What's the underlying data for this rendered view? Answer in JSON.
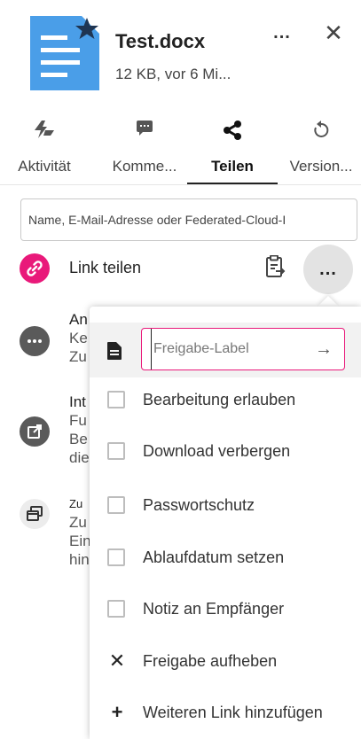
{
  "header": {
    "file_name": "Test.docx",
    "file_meta": "12 KB, vor 6 Mi...",
    "more_label": "...",
    "close_label": "✕"
  },
  "tabs": [
    {
      "label": "Aktivität",
      "icon": "activity-icon",
      "active": false
    },
    {
      "label": "Komme...",
      "icon": "comment-icon",
      "active": false
    },
    {
      "label": "Teilen",
      "icon": "share-icon",
      "active": true
    },
    {
      "label": "Version...",
      "icon": "history-icon",
      "active": false
    }
  ],
  "share_search": {
    "placeholder": "Name, E-Mail-Adresse oder Federated-Cloud-I"
  },
  "link_share": {
    "label": "Link teilen",
    "accent": "#e9197a",
    "menu_label": "..."
  },
  "background_items": [
    {
      "lines": [
        "An",
        "Ke",
        "Zu"
      ],
      "icon": "more-icon"
    },
    {
      "lines": [
        "Int",
        "Fu",
        "Be",
        "die"
      ],
      "icon": "external-link-icon"
    },
    {
      "lines": [
        "Zu",
        "Zu",
        "Ein",
        "hin"
      ],
      "icon": "windows-icon"
    }
  ],
  "popup": {
    "label_input_placeholder": "Freigabe-Label",
    "submit_label": "→",
    "options": [
      {
        "label": "Bearbeitung erlauben",
        "checked": false
      },
      {
        "label": "Download verbergen",
        "checked": false
      },
      {
        "label": "Passwortschutz",
        "checked": false
      },
      {
        "label": "Ablaufdatum setzen",
        "checked": false
      },
      {
        "label": "Notiz an Empfänger",
        "checked": false
      }
    ],
    "unshare_label": "Freigabe aufheben",
    "unshare_icon": "✕",
    "add_link_label": "Weiteren Link hinzufügen",
    "add_link_icon": "+"
  },
  "colors": {
    "file_icon": "#4a9ee8",
    "accent_pink": "#e9197a"
  }
}
